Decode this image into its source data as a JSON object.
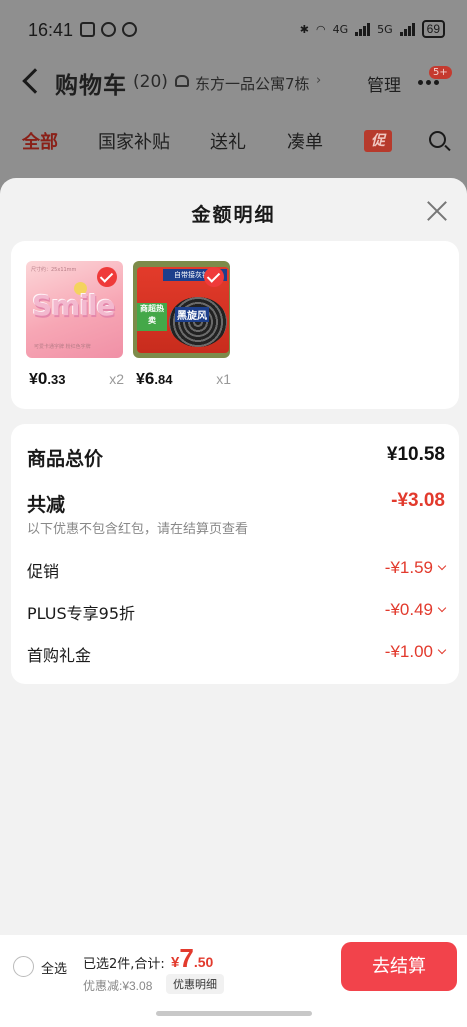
{
  "status_bar": {
    "time": "16:41",
    "network_label": "4G",
    "network_label2": "5G",
    "battery": "69"
  },
  "header": {
    "title": "购物车",
    "count": "(20)",
    "location": "东方一品公寓7栋",
    "location_arrow": "›",
    "manage_label": "管理",
    "badge": "5+"
  },
  "filters": {
    "items": [
      "全部",
      "国家补贴",
      "送礼",
      "凑单"
    ],
    "promo_tag": "促"
  },
  "sheet": {
    "title": "金额明细",
    "products": [
      {
        "image_caption_top": "尺寸约：25x11mm",
        "image_word": "Smile",
        "image_caption_bottom": "可爱卡通字牌 粉红色字牌",
        "price_symbol": "¥",
        "price_int": "0",
        "price_dec": ".33",
        "qty": "x2"
      },
      {
        "image_banner": "自带接灰铁盘",
        "image_label": "商超热卖",
        "image_brand": "黑旋风",
        "price_symbol": "¥",
        "price_int": "6",
        "price_dec": ".84",
        "qty": "x1"
      }
    ],
    "summary": {
      "total_label": "商品总价",
      "total_value": "¥10.58",
      "reduce_label": "共减",
      "reduce_value": "-¥3.08",
      "note": "以下优惠不包含红包，请在结算页查看",
      "lines": [
        {
          "label": "促销",
          "value": "-¥1.59"
        },
        {
          "label": "PLUS专享95折",
          "value": "-¥0.49"
        },
        {
          "label": "首购礼金",
          "value": "-¥1.00"
        }
      ]
    }
  },
  "bottom_bar": {
    "select_all": "全选",
    "selected_text": "已选2件,合计:",
    "price_symbol": "¥",
    "price_int": "7",
    "price_dec": ".50",
    "discount_text": "优惠减:¥3.08",
    "detail_chip": "优惠明细",
    "checkout": "去结算"
  },
  "colors": {
    "accent_red": "#e23a2d",
    "checkout_button": "#f2434b",
    "sheet_background": "#f2f2f2"
  }
}
